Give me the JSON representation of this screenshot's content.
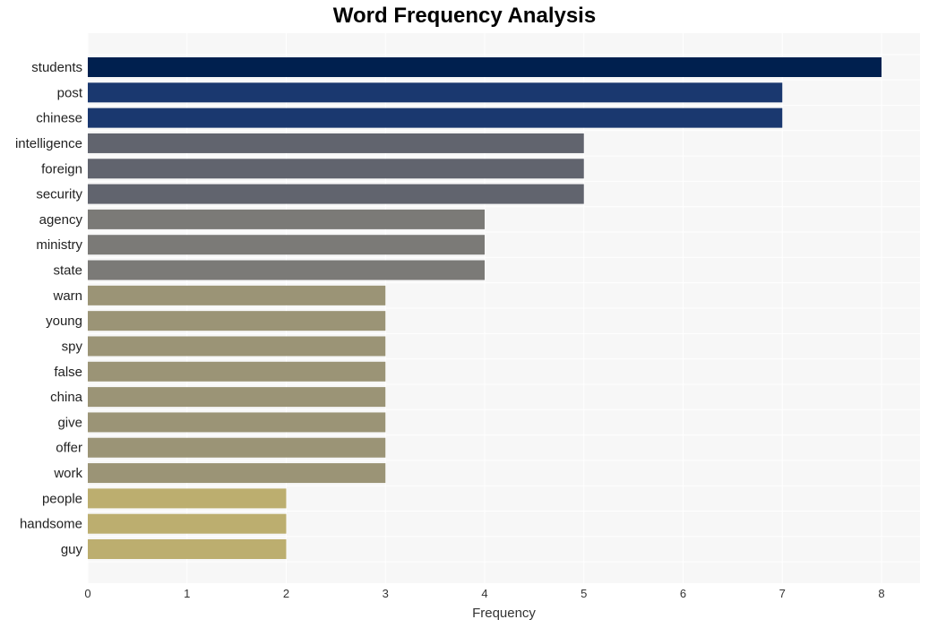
{
  "chart_data": {
    "type": "bar",
    "orientation": "horizontal",
    "title": "Word Frequency Analysis",
    "xlabel": "Frequency",
    "ylabel": "",
    "xlim": [
      0,
      8.4
    ],
    "x_ticks": [
      0,
      1,
      2,
      3,
      4,
      5,
      6,
      7,
      8
    ],
    "grid": true,
    "categories": [
      "students",
      "post",
      "chinese",
      "intelligence",
      "foreign",
      "security",
      "agency",
      "ministry",
      "state",
      "warn",
      "young",
      "spy",
      "false",
      "china",
      "give",
      "offer",
      "work",
      "people",
      "handsome",
      "guy"
    ],
    "values": [
      8,
      7,
      7,
      5,
      5,
      5,
      4,
      4,
      4,
      3,
      3,
      3,
      3,
      3,
      3,
      3,
      3,
      2,
      2,
      2
    ],
    "colors_by_value": {
      "8": "#00204f",
      "7": "#1a386f",
      "5": "#61646e",
      "4": "#7b7a77",
      "3": "#9b9476",
      "2": "#bcae6f"
    },
    "plot_background": "#f7f7f7",
    "grid_color": "#ffffff"
  }
}
